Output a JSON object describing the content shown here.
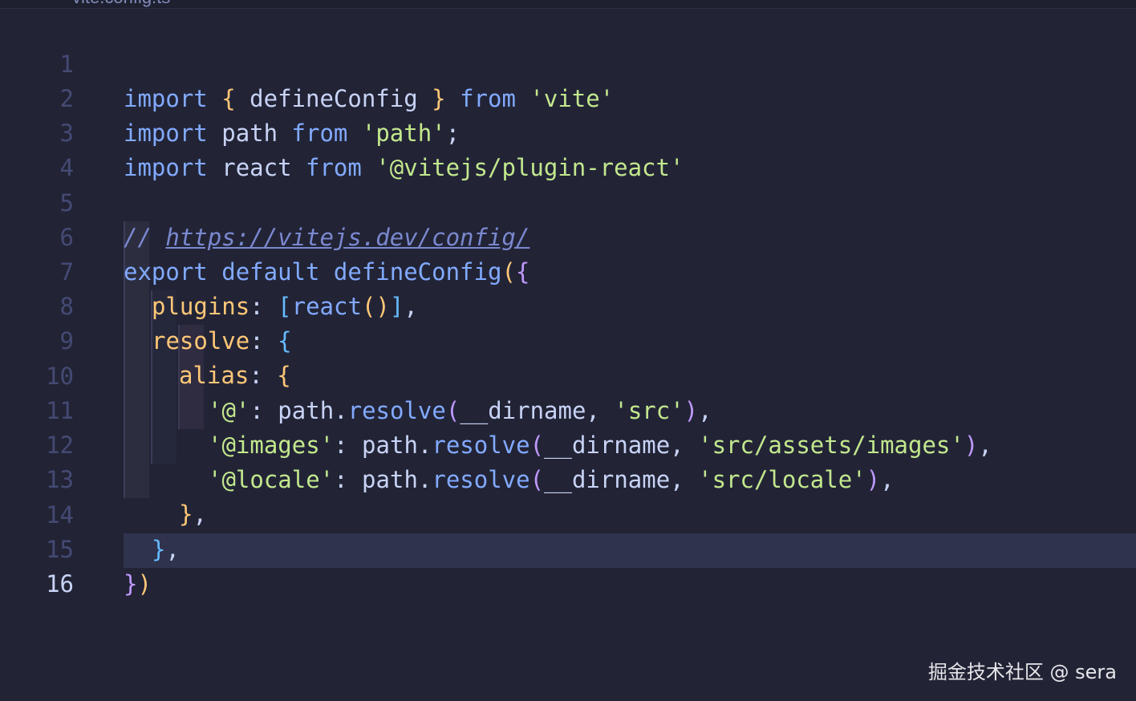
{
  "editor": {
    "breadcrumb": "vite.config.ts",
    "active_line": 16,
    "lines": [
      {
        "n": "1"
      },
      {
        "n": "2"
      },
      {
        "n": "3"
      },
      {
        "n": "4"
      },
      {
        "n": "5"
      },
      {
        "n": "6"
      },
      {
        "n": "7"
      },
      {
        "n": "8"
      },
      {
        "n": "9"
      },
      {
        "n": "10"
      },
      {
        "n": "11"
      },
      {
        "n": "12"
      },
      {
        "n": "13"
      },
      {
        "n": "14"
      },
      {
        "n": "15"
      },
      {
        "n": "16"
      }
    ],
    "code": {
      "l1": {
        "a": "import",
        "b": "{",
        "c": "defineConfig",
        "d": "}",
        "e": "from",
        "f": "'vite'"
      },
      "l2": {
        "a": "import",
        "b": "path",
        "c": "from",
        "d": "'path'",
        "e": ";"
      },
      "l3": {
        "a": "import",
        "b": "react",
        "c": "from",
        "d": "'@vitejs/plugin-react'"
      },
      "l5": {
        "a": "//",
        "b": "https://vitejs.dev/config/"
      },
      "l6": {
        "a": "export",
        "b": "default",
        "c": "defineConfig",
        "d": "(",
        "e": "{"
      },
      "l7": {
        "a": "plugins",
        "b": ":",
        "c": "[",
        "d": "react",
        "e": "(",
        "f": ")",
        "g": "]",
        "h": ","
      },
      "l8": {
        "a": "resolve",
        "b": ":",
        "c": "{"
      },
      "l9": {
        "a": "alias",
        "b": ":",
        "c": "{"
      },
      "l10": {
        "a": "'@'",
        "b": ": path.",
        "c": "resolve",
        "d": "(",
        "e": "__dirname, ",
        "f": "'src'",
        "g": ")",
        "h": ","
      },
      "l11": {
        "a": "'@images'",
        "b": ": path.",
        "c": "resolve",
        "d": "(",
        "e": "__dirname, ",
        "f": "'src/assets/images'",
        "g": ")",
        "h": ","
      },
      "l12": {
        "a": "'@locale'",
        "b": ": path.",
        "c": "resolve",
        "d": "(",
        "e": "__dirname, ",
        "f": "'src/locale'",
        "g": ")",
        "h": ","
      },
      "l13": {
        "a": "}",
        "b": ","
      },
      "l14": {
        "a": "}",
        "b": ","
      },
      "l15": {
        "a": "}",
        "b": ")"
      }
    }
  },
  "watermark": "掘金技术社区 @ sera"
}
